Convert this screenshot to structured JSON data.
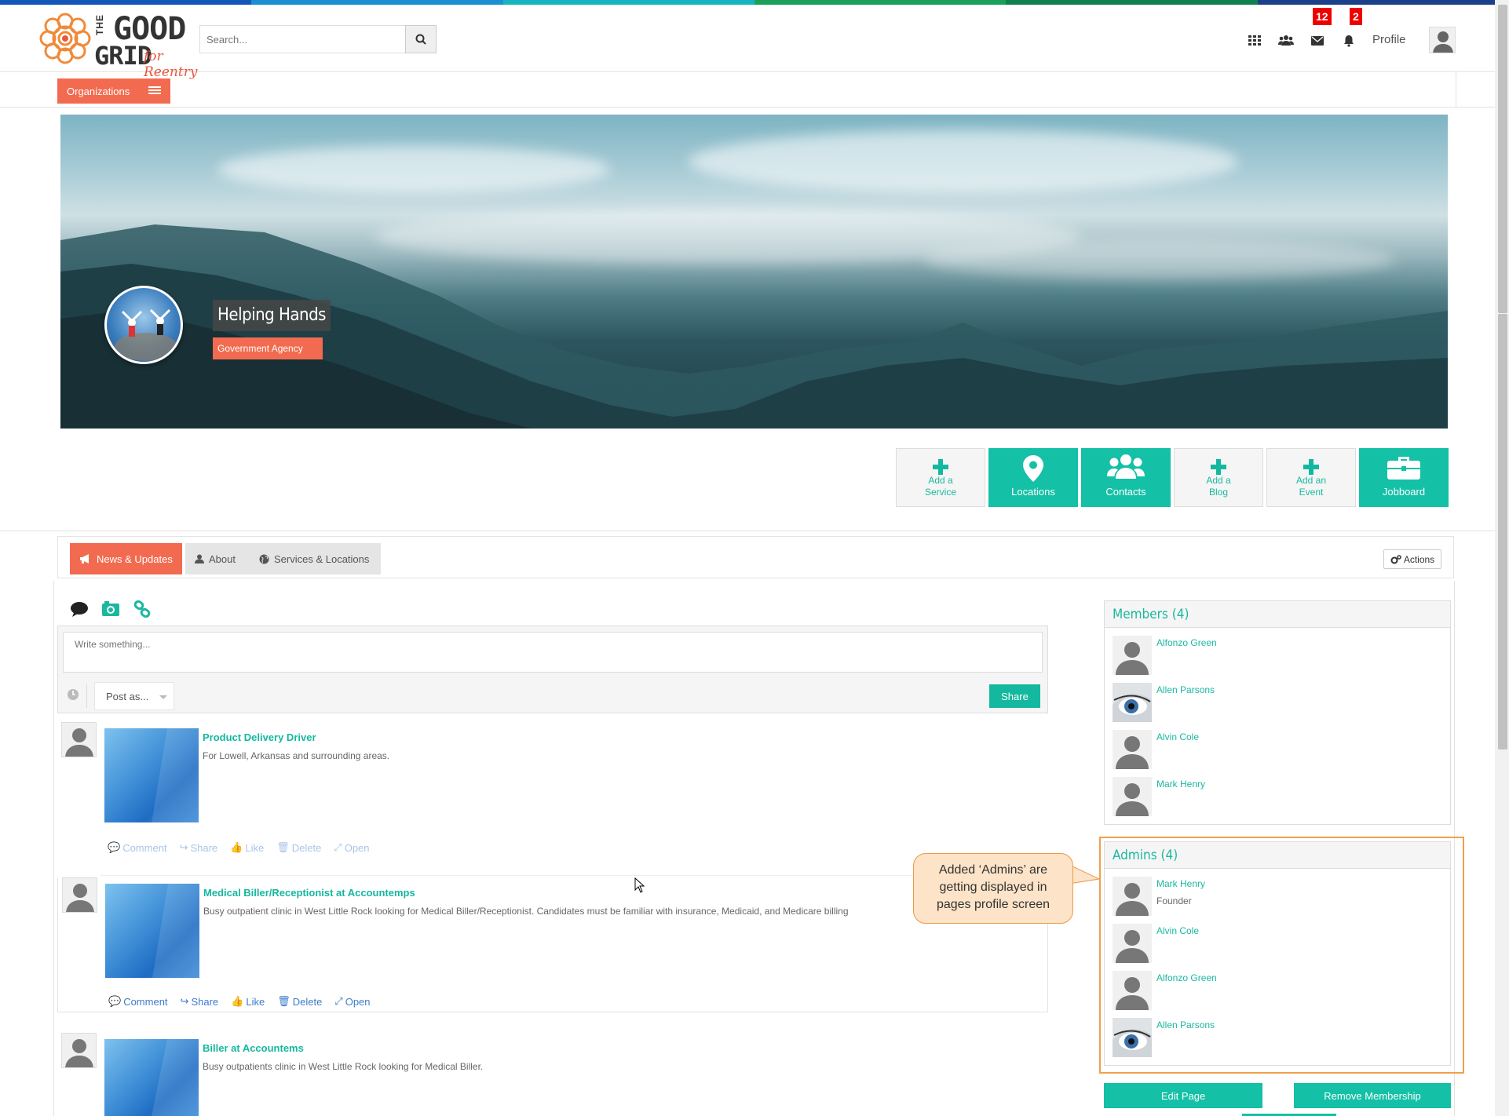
{
  "colors": {
    "accent": "#14c0a6",
    "orange": "#f26b50",
    "stripe": [
      "#1456b8",
      "#1b8fd1",
      "#16b4c0",
      "#1aa05a",
      "#10804e",
      "#1c3f8a"
    ]
  },
  "header": {
    "logo": {
      "the": "THE",
      "good": "GOOD",
      "grid": "GRID",
      "tagline": "for Reentry"
    },
    "search": {
      "placeholder": "Search...",
      "icon": "search-icon"
    },
    "icons": [
      "apps-grid-icon",
      "people-icon",
      "envelope-icon",
      "bell-icon"
    ],
    "messages_badge": "12",
    "notifications_badge": "2",
    "profile_label": "Profile"
  },
  "org_bar": {
    "label": "Organizations"
  },
  "cover": {
    "org_name": "Helping Hands",
    "org_type": "Government Agency"
  },
  "tiles": [
    {
      "label": "Add a Service",
      "icon": "plus-icon",
      "solid": false
    },
    {
      "label": "Locations",
      "icon": "map-marker-icon",
      "solid": true
    },
    {
      "label": "Contacts",
      "icon": "contacts-icon",
      "solid": true
    },
    {
      "label": "Add a Blog",
      "icon": "plus-icon",
      "solid": false
    },
    {
      "label": "Add an Event",
      "icon": "plus-icon",
      "solid": false
    },
    {
      "label": "Jobboard",
      "icon": "briefcase-icon",
      "solid": true
    }
  ],
  "tabs": [
    {
      "label": "News & Updates",
      "icon": "bullhorn-icon",
      "active": true
    },
    {
      "label": "About",
      "icon": "user-icon",
      "active": false
    },
    {
      "label": "Services & Locations",
      "icon": "globe-icon",
      "active": false
    }
  ],
  "actions_label": "Actions",
  "composer": {
    "placeholder": "Write something...",
    "post_as": "Post as...",
    "share": "Share"
  },
  "posts": [
    {
      "title": "Product Delivery Driver",
      "desc": "For Lowell, Arkansas and surrounding areas."
    },
    {
      "title": "Medical Biller/Receptionist at Accountemps",
      "desc": "Busy outpatient clinic in West Little Rock looking for Medical Biller/Receptionist. Candidates must be familiar with insurance, Medicaid, and Medicare billing"
    },
    {
      "title": "Biller at Accountems",
      "desc": "Busy outpatients clinic in West Little Rock looking for Medical Biller."
    }
  ],
  "post_actions": [
    "Comment",
    "Share",
    "Like",
    "Delete",
    "Open"
  ],
  "members": {
    "title": "Members (4)",
    "list": [
      {
        "name": "Alfonzo Green",
        "avatar": "silhouette"
      },
      {
        "name": "Allen Parsons",
        "avatar": "eye"
      },
      {
        "name": "Alvin Cole",
        "avatar": "silhouette"
      },
      {
        "name": "Mark Henry",
        "avatar": "silhouette"
      }
    ]
  },
  "admins": {
    "title": "Admins (4)",
    "list": [
      {
        "name": "Mark Henry",
        "role": "Founder",
        "avatar": "silhouette"
      },
      {
        "name": "Alvin Cole",
        "role": "",
        "avatar": "silhouette"
      },
      {
        "name": "Alfonzo Green",
        "role": "",
        "avatar": "silhouette"
      },
      {
        "name": "Allen Parsons",
        "role": "",
        "avatar": "eye"
      }
    ]
  },
  "callout": {
    "line1": "Added ‘Admins’ are",
    "line2": "getting displayed in",
    "line3": "pages profile screen"
  },
  "buttons": {
    "edit": "Edit Page",
    "remove": "Remove Membership"
  }
}
